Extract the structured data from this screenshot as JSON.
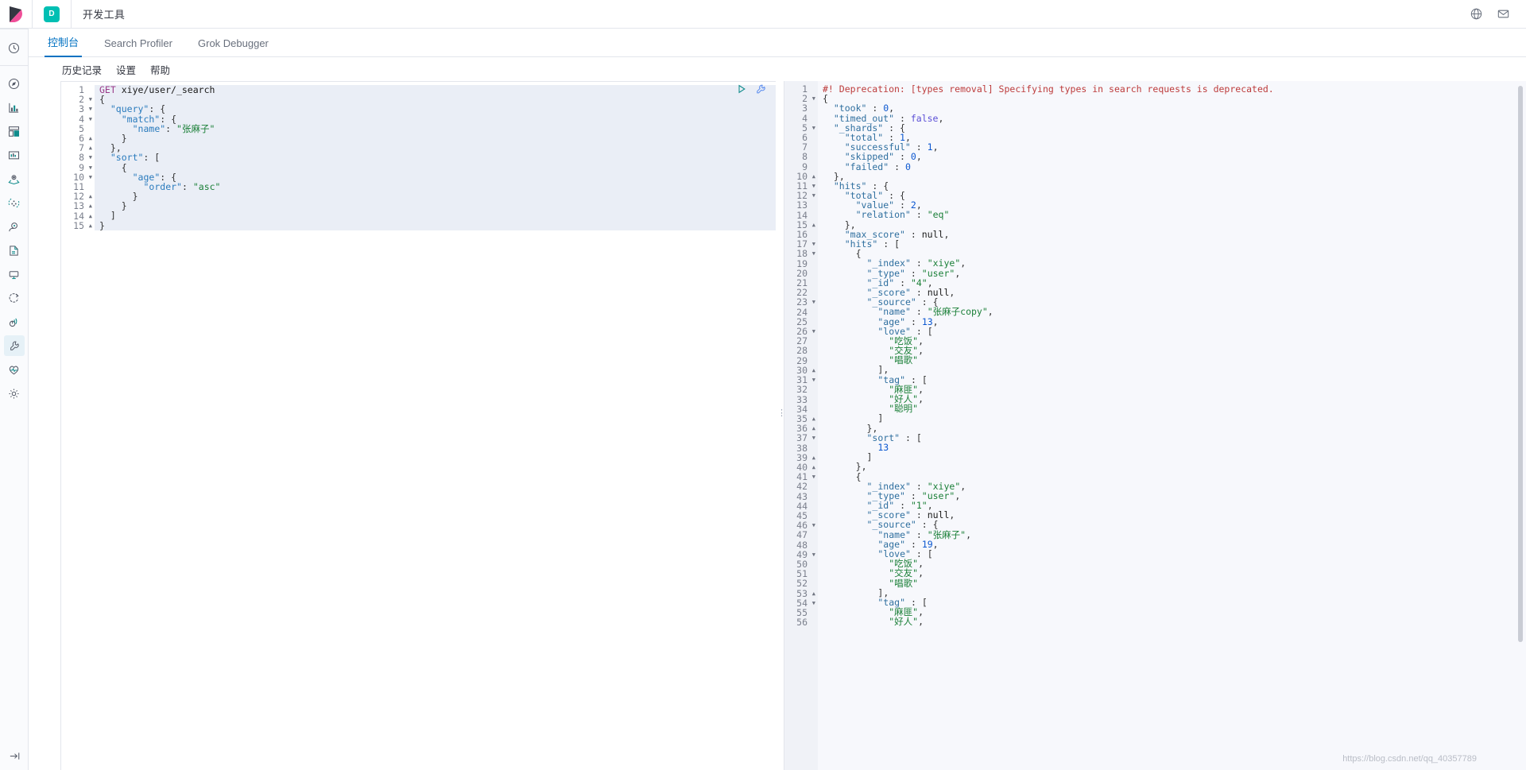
{
  "header": {
    "app_badge": "D",
    "title": "开发工具",
    "icons": [
      {
        "name": "help-globe-icon",
        "glyph": "help"
      },
      {
        "name": "mail-icon",
        "glyph": "mail"
      }
    ]
  },
  "sidebar": {
    "items": [
      {
        "name": "sidebar-item-recently-viewed",
        "icon": "clock-icon"
      },
      {
        "name": "sidebar-item-discover",
        "icon": "compass-icon"
      },
      {
        "name": "sidebar-item-visualize",
        "icon": "bar-chart-icon"
      },
      {
        "name": "sidebar-item-dashboard",
        "icon": "dashboard-icon"
      },
      {
        "name": "sidebar-item-canvas",
        "icon": "presentation-icon"
      },
      {
        "name": "sidebar-item-maps",
        "icon": "map-pin-icon"
      },
      {
        "name": "sidebar-item-machine-learning",
        "icon": "nodes-icon"
      },
      {
        "name": "sidebar-item-infrastructure",
        "icon": "infra-icon"
      },
      {
        "name": "sidebar-item-logs",
        "icon": "logs-icon"
      },
      {
        "name": "sidebar-item-apm",
        "icon": "apm-icon"
      },
      {
        "name": "sidebar-item-uptime",
        "icon": "uptime-icon"
      },
      {
        "name": "sidebar-item-siem",
        "icon": "siem-icon"
      },
      {
        "name": "sidebar-item-dev-tools",
        "icon": "wrench-icon"
      },
      {
        "name": "sidebar-item-monitoring",
        "icon": "heart-icon"
      },
      {
        "name": "sidebar-item-management",
        "icon": "gear-icon"
      }
    ],
    "collapse": {
      "name": "collapse-sidebar-button",
      "icon": "arrow-collapse-icon"
    }
  },
  "tabs": [
    {
      "label": "控制台",
      "selected": true
    },
    {
      "label": "Search Profiler",
      "selected": false
    },
    {
      "label": "Grok Debugger",
      "selected": false
    }
  ],
  "subtabs": [
    {
      "label": "历史记录"
    },
    {
      "label": "设置"
    },
    {
      "label": "帮助"
    }
  ],
  "console": {
    "play_button_label": "发送请求",
    "wrench_button_label": "操作",
    "request": {
      "line_count": 15,
      "lines": [
        "GET xiye/user/_search",
        "{",
        "  \"query\": {",
        "    \"match\": {",
        "      \"name\": \"张麻子\"",
        "    }",
        "  },",
        "  \"sort\": [",
        "    {",
        "      \"age\": {",
        "        \"order\": \"asc\"",
        "      }",
        "    }",
        "  ]",
        "}"
      ],
      "folds": [
        "",
        "down",
        "down",
        "down",
        "",
        "up",
        "up",
        "down",
        "down",
        "down",
        "",
        "up",
        "up",
        "up",
        "up"
      ]
    },
    "response": {
      "first_visible_line": 1,
      "last_visible_line": 56,
      "deprecation_warning": "#! Deprecation: [types removal] Specifying types in search requests is deprecated.",
      "lines": [
        "#! Deprecation: [types removal] Specifying types in search requests is deprecated.",
        "{",
        "  \"took\" : 0,",
        "  \"timed_out\" : false,",
        "  \"_shards\" : {",
        "    \"total\" : 1,",
        "    \"successful\" : 1,",
        "    \"skipped\" : 0,",
        "    \"failed\" : 0",
        "  },",
        "  \"hits\" : {",
        "    \"total\" : {",
        "      \"value\" : 2,",
        "      \"relation\" : \"eq\"",
        "    },",
        "    \"max_score\" : null,",
        "    \"hits\" : [",
        "      {",
        "        \"_index\" : \"xiye\",",
        "        \"_type\" : \"user\",",
        "        \"_id\" : \"4\",",
        "        \"_score\" : null,",
        "        \"_source\" : {",
        "          \"name\" : \"张麻子copy\",",
        "          \"age\" : 13,",
        "          \"love\" : [",
        "            \"吃饭\",",
        "            \"交友\",",
        "            \"唱歌\"",
        "          ],",
        "          \"tag\" : [",
        "            \"麻匪\",",
        "            \"好人\",",
        "            \"聪明\"",
        "          ]",
        "        },",
        "        \"sort\" : [",
        "          13",
        "        ]",
        "      },",
        "      {",
        "        \"_index\" : \"xiye\",",
        "        \"_type\" : \"user\",",
        "        \"_id\" : \"1\",",
        "        \"_score\" : null,",
        "        \"_source\" : {",
        "          \"name\" : \"张麻子\",",
        "          \"age\" : 19,",
        "          \"love\" : [",
        "            \"吃饭\",",
        "            \"交友\",",
        "            \"唱歌\"",
        "          ],",
        "          \"tag\" : [",
        "            \"麻匪\",",
        "            \"好人\","
      ],
      "folds": [
        "",
        "down",
        "",
        "",
        "down",
        "",
        "",
        "",
        "",
        "up",
        "down",
        "down",
        "",
        "",
        "up",
        "",
        "down",
        "down",
        "",
        "",
        "",
        "",
        "down",
        "",
        "",
        "down",
        "",
        "",
        "",
        "up",
        "down",
        "",
        "",
        "",
        "up",
        "up",
        "down",
        "",
        "up",
        "up",
        "down",
        "",
        "",
        "",
        "",
        "down",
        "",
        "",
        "down",
        "",
        "",
        "",
        "up",
        "down",
        "",
        ""
      ]
    }
  },
  "watermark": "https://blog.csdn.net/qq_40357789",
  "colors": {
    "accent": "#00bfb3",
    "link": "#0071c2",
    "warning": "#bd3c3c",
    "string": "#1a7f37",
    "key": "#2a7bbd"
  }
}
